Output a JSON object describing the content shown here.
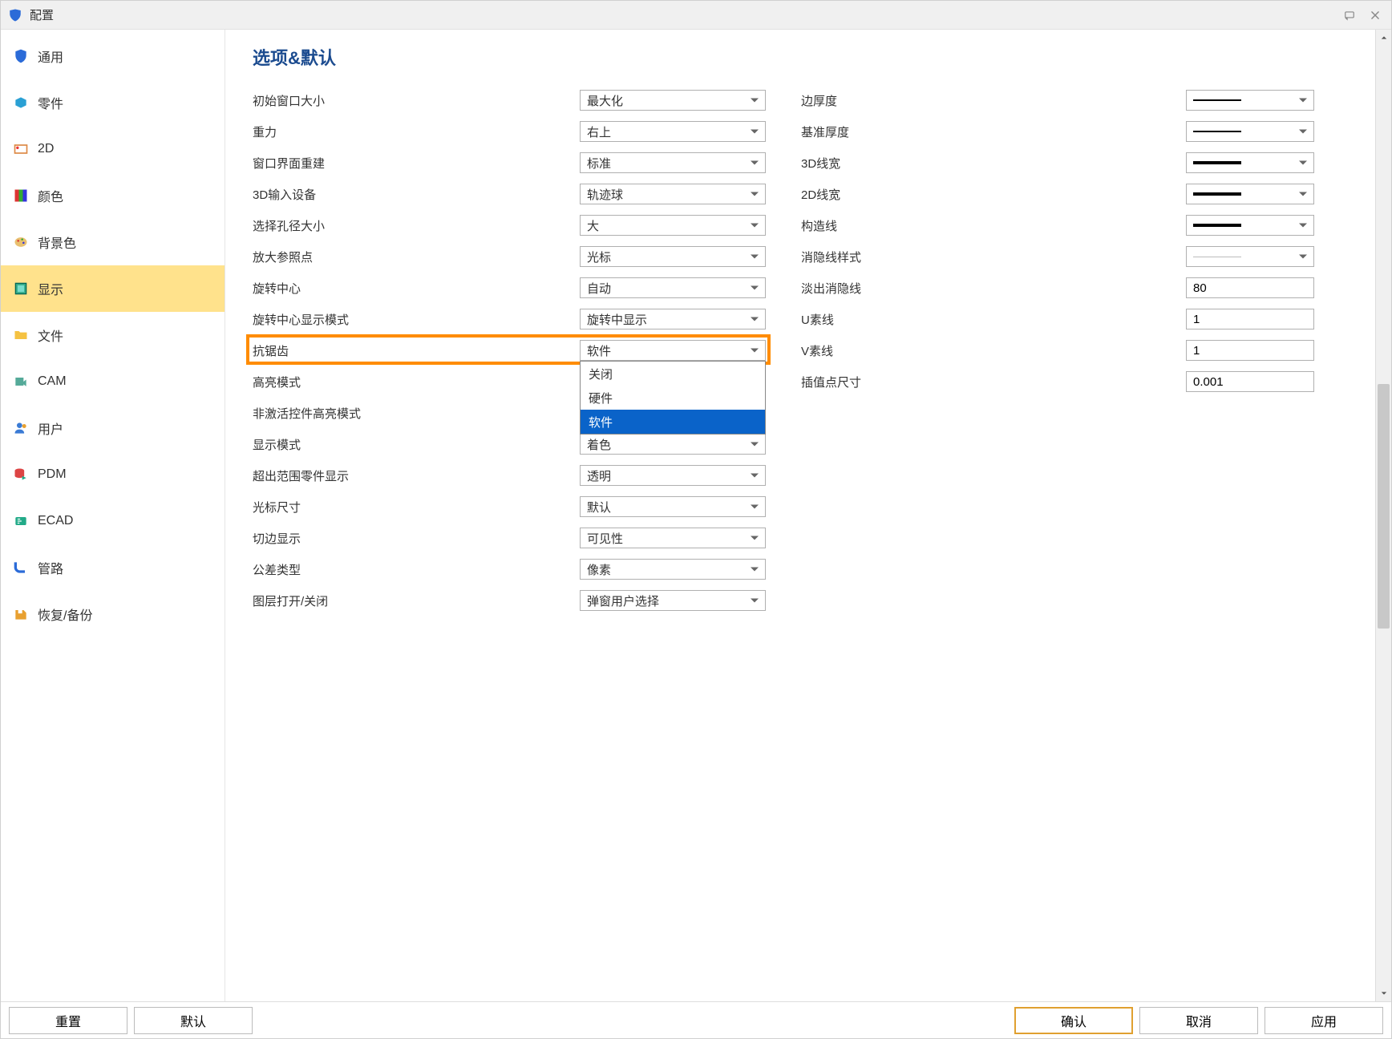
{
  "window": {
    "title": "配置"
  },
  "sidebar": {
    "items": [
      {
        "label": "通用"
      },
      {
        "label": "零件"
      },
      {
        "label": "2D"
      },
      {
        "label": "颜色"
      },
      {
        "label": "背景色"
      },
      {
        "label": "显示"
      },
      {
        "label": "文件"
      },
      {
        "label": "CAM"
      },
      {
        "label": "用户"
      },
      {
        "label": "PDM"
      },
      {
        "label": "ECAD"
      },
      {
        "label": "管路"
      },
      {
        "label": "恢复/备份"
      }
    ],
    "selected_index": 5
  },
  "heading": "选项&默认",
  "left_options": [
    {
      "label": "初始窗口大小",
      "value": "最大化"
    },
    {
      "label": "重力",
      "value": "右上"
    },
    {
      "label": "窗口界面重建",
      "value": "标准"
    },
    {
      "label": "3D输入设备",
      "value": "轨迹球"
    },
    {
      "label": "选择孔径大小",
      "value": "大"
    },
    {
      "label": "放大参照点",
      "value": "光标"
    },
    {
      "label": "旋转中心",
      "value": "自动"
    },
    {
      "label": "旋转中心显示模式",
      "value": "旋转中显示"
    },
    {
      "label": "抗锯齿",
      "value": "软件"
    },
    {
      "label": "高亮模式",
      "value": ""
    },
    {
      "label": "非激活控件高亮模式",
      "value": ""
    },
    {
      "label": "显示模式",
      "value": "着色"
    },
    {
      "label": "超出范围零件显示",
      "value": "透明"
    },
    {
      "label": "光标尺寸",
      "value": "默认"
    },
    {
      "label": "切边显示",
      "value": "可见性"
    },
    {
      "label": "公差类型",
      "value": "像素"
    },
    {
      "label": "图层打开/关闭",
      "value": "弹窗用户选择"
    }
  ],
  "right_options": [
    {
      "label": "边厚度",
      "kind": "line-solid"
    },
    {
      "label": "基准厚度",
      "kind": "line-solid"
    },
    {
      "label": "3D线宽",
      "kind": "line-thick"
    },
    {
      "label": "2D线宽",
      "kind": "line-thick"
    },
    {
      "label": "构造线",
      "kind": "line-thick"
    },
    {
      "label": "消隐线样式",
      "kind": "line-faded"
    }
  ],
  "right_inputs": [
    {
      "label": "淡出消隐线",
      "value": "80"
    },
    {
      "label": "U素线",
      "value": "1"
    },
    {
      "label": "V素线",
      "value": "1"
    },
    {
      "label": "插值点尺寸",
      "value": "0.001"
    }
  ],
  "dropdown": {
    "options": [
      "关闭",
      "硬件",
      "软件"
    ],
    "selected_index": 2
  },
  "footer": {
    "reset": "重置",
    "default": "默认",
    "ok": "确认",
    "cancel": "取消",
    "apply": "应用"
  }
}
